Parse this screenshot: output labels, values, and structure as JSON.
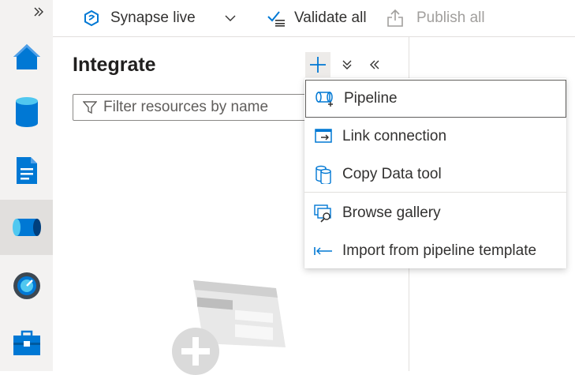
{
  "rail": {
    "expand_icon": "double-chevron-right-icon",
    "items": [
      {
        "name": "home",
        "icon": "home-icon"
      },
      {
        "name": "data",
        "icon": "database-icon"
      },
      {
        "name": "develop",
        "icon": "document-icon"
      },
      {
        "name": "integrate",
        "icon": "pipeline-icon",
        "active": true
      },
      {
        "name": "monitor",
        "icon": "gauge-icon"
      },
      {
        "name": "manage",
        "icon": "toolbox-icon"
      }
    ]
  },
  "toolbar": {
    "workspace_label": "Synapse live",
    "validate_label": "Validate all",
    "publish_label": "Publish all"
  },
  "integrate": {
    "title": "Integrate",
    "filter_placeholder": "Filter resources by name"
  },
  "menu": {
    "items": [
      {
        "label": "Pipeline",
        "icon": "pipeline-add-icon"
      },
      {
        "label": "Link connection",
        "icon": "link-connection-icon"
      },
      {
        "label": "Copy Data tool",
        "icon": "copy-data-icon"
      },
      {
        "label": "Browse gallery",
        "icon": "gallery-icon"
      },
      {
        "label": "Import from pipeline template",
        "icon": "import-arrow-icon"
      }
    ]
  },
  "colors": {
    "accent": "#0078d4",
    "rail_bg": "#f3f2f1",
    "rail_active": "#e1dfdd",
    "disabled_text": "#a19f9d"
  }
}
